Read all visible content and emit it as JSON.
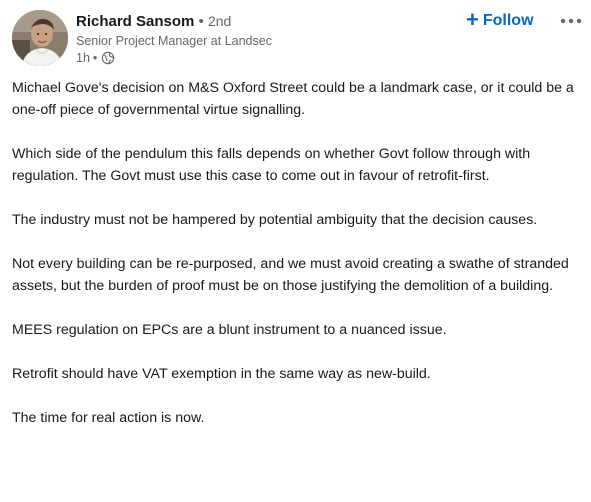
{
  "author": {
    "name": "Richard Sansom",
    "separator": "•",
    "degree": "2nd",
    "headline": "Senior Project Manager at Landsec",
    "time": "1h",
    "time_separator": "•",
    "visibility_icon": "globe-icon"
  },
  "actions": {
    "follow_icon": "+",
    "follow_label": "Follow",
    "more_icon": "ellipsis-icon"
  },
  "post": {
    "paragraphs": [
      "Michael Gove's decision on M&S Oxford Street could be a landmark case, or it could be a one-off piece of governmental virtue signalling.",
      "Which side of the pendulum this falls depends on whether Govt follow through with regulation. The Govt must use this case to come out in favour of retrofit-first.",
      "The industry must not be hampered by potential ambiguity that the decision causes.",
      "Not every building can be re-purposed, and we must avoid creating a swathe of stranded assets, but the burden of proof must be on those justifying the demolition of a building.",
      "MEES regulation on EPCs are a blunt instrument to a nuanced issue.",
      "Retrofit should have VAT exemption in the same way as new-build.",
      "The time for real action is now."
    ]
  },
  "colors": {
    "accent": "#0a66c2",
    "text": "#191919",
    "muted": "#666666",
    "background": "#ffffff"
  }
}
